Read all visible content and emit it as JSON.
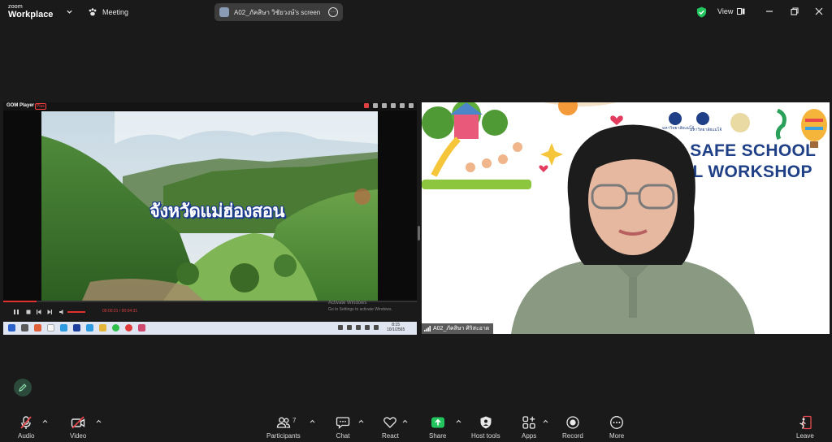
{
  "top_bar": {
    "brand_top": "zoom",
    "brand_main": "Workplace",
    "meeting_label": "Meeting",
    "screen_share_label": "A02_ภัคสิษา วิชัยวงษ์'s screen",
    "view_label": "View"
  },
  "left_tile": {
    "player_name": "GOM Player",
    "player_plus": "Plus",
    "video_caption": "จังหวัดแม่ฮ่องสอน",
    "time_current": "00:00:21",
    "time_total": "00:04:31",
    "watermark_line1": "Activate Windows",
    "watermark_line2": "Go to Settings to activate Windows.",
    "progress_fraction": 0.08,
    "clock_time": "8:15",
    "clock_date": "10/1/2565"
  },
  "right_tile": {
    "banner_line1": "I SAFE SCHOOL",
    "banner_line2": "AL WORKSHOP",
    "banner_small1": "มหาวิทยาลัยแม่โจ้",
    "banner_small2": "มหาวิทยาลัยแม่โจ้",
    "participant_name": "A02_ภัคสิษา ศิริสะอาด"
  },
  "toolbar": {
    "audio": "Audio",
    "video": "Video",
    "participants": "Participants",
    "participants_count": "7",
    "chat": "Chat",
    "react": "React",
    "share": "Share",
    "host_tools": "Host tools",
    "apps": "Apps",
    "record": "Record",
    "more": "More",
    "leave": "Leave"
  },
  "colors": {
    "background": "#1a1a1a",
    "share_green": "#22c55e",
    "leave_red": "#e5484d",
    "banner_blue": "#1f3f86"
  }
}
